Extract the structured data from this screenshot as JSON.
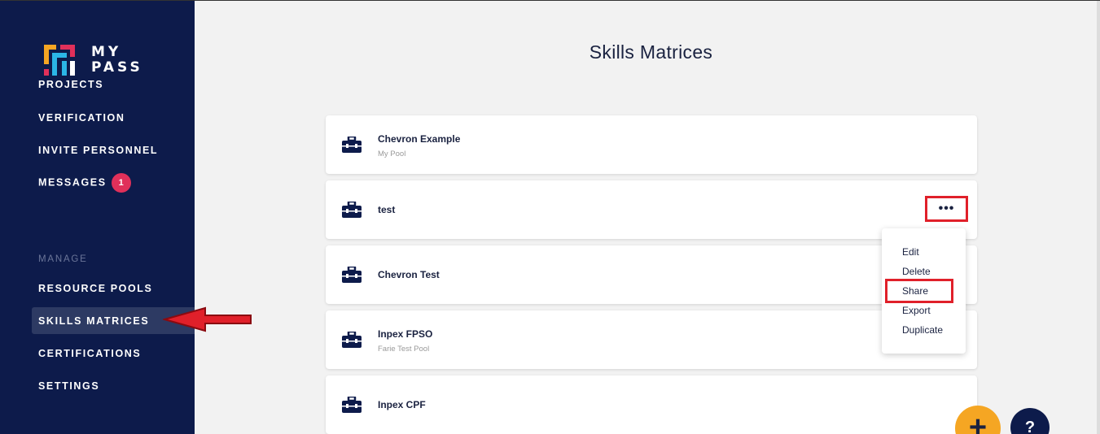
{
  "brand": {
    "line1": "MY",
    "line2": "PASS"
  },
  "sidebar": {
    "items": [
      {
        "label": "PROJECTS"
      },
      {
        "label": "VERIFICATION"
      },
      {
        "label": "INVITE PERSONNEL"
      },
      {
        "label": "MESSAGES",
        "badge": "1"
      }
    ],
    "manage_label": "MANAGE",
    "manage_items": [
      {
        "label": "RESOURCE POOLS"
      },
      {
        "label": "SKILLS MATRICES"
      },
      {
        "label": "CERTIFICATIONS"
      },
      {
        "label": "SETTINGS"
      }
    ]
  },
  "main": {
    "title": "Skills Matrices",
    "cards": [
      {
        "name": "Chevron Example",
        "sub": "My Pool"
      },
      {
        "name": "test",
        "sub": ""
      },
      {
        "name": "Chevron Test",
        "sub": ""
      },
      {
        "name": "Inpex FPSO",
        "sub": "Farie Test Pool"
      },
      {
        "name": "Inpex CPF",
        "sub": ""
      }
    ],
    "more_label": "•••"
  },
  "context_menu": {
    "items": [
      {
        "label": "Edit"
      },
      {
        "label": "Delete"
      },
      {
        "label": "Share"
      },
      {
        "label": "Export"
      },
      {
        "label": "Duplicate"
      }
    ]
  },
  "fab": {
    "add_label": "+",
    "help_label": "?"
  },
  "colors": {
    "sidebar": "#0d1b4b",
    "accent": "#f5a623",
    "badge": "#e0305a",
    "highlight": "#e0202a"
  }
}
